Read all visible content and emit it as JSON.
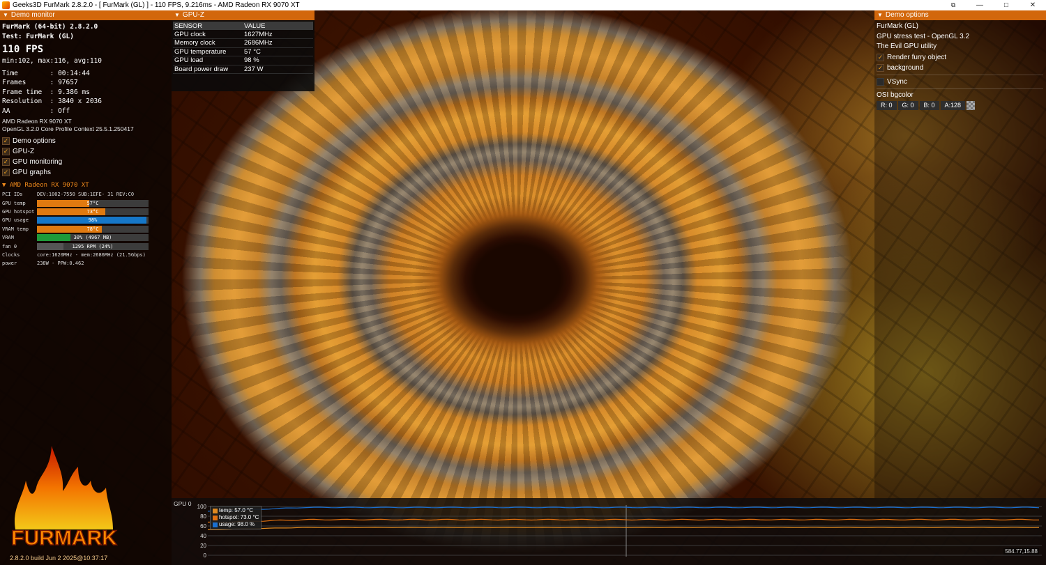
{
  "window": {
    "title": "Geeks3D FurMark 2.8.2.0 - [ FurMark (GL) ] - 110 FPS, 9.216ms - AMD Radeon RX 9070 XT",
    "minimize_glyph": "—",
    "maximize_glyph": "□",
    "close_glyph": "✕",
    "extra_glyph": "⧉"
  },
  "demo_monitor": {
    "header": "Demo monitor",
    "app_name": "FurMark (64-bit) 2.8.2.0",
    "test": "Test: FurMark (GL)",
    "fps": "110 FPS",
    "fps_stats": "min:102, max:116, avg:110",
    "time": "Time        : 00:14:44",
    "frames": "Frames      : 97657",
    "frame_time": "Frame time  : 9.386 ms",
    "resolution": "Resolution  : 3840 x 2036",
    "aa": "AA          : Off",
    "gpu_name": "AMD Radeon RX 9070 XT",
    "gl_context": "OpenGL 3.2.0 Core Profile Context 25.5.1.250417",
    "toggles": [
      {
        "label": "Demo options",
        "checked": true
      },
      {
        "label": "GPU-Z",
        "checked": true
      },
      {
        "label": "GPU monitoring",
        "checked": true
      },
      {
        "label": "GPU graphs",
        "checked": true
      }
    ],
    "gpu_section_header": "AMD Radeon RX 9070 XT",
    "pci_label": "PCI IDs",
    "pci_value": "DEV:1002-7550 SUB:1EFE-  31 REV:C0",
    "bars": [
      {
        "label": "GPU temp",
        "text": "57°C",
        "fraction": 0.47,
        "color": "#e07a10"
      },
      {
        "label": "GPU hotspot",
        "text": "73°C",
        "fraction": 0.61,
        "color": "#e07a10"
      },
      {
        "label": "GPU usage",
        "text": "98%",
        "fraction": 0.98,
        "color": "#1677c8"
      },
      {
        "label": "VRAM temp",
        "text": "78°C",
        "fraction": 0.58,
        "color": "#e07a10"
      },
      {
        "label": "VRAM",
        "text": "30% (4967 MB)",
        "fraction": 0.3,
        "color": "#1f9a3a"
      },
      {
        "label": "fan 0",
        "text": "1295 RPM (24%)",
        "fraction": 0.24,
        "color": "#555555"
      }
    ],
    "clocks_label": "Clocks",
    "clocks_value": "core:1620MHz - mem:2686MHz (21.5Gbps)",
    "power_label": "power",
    "power_value": "238W - PPW:0.462",
    "logo_text": "FURMARK",
    "build": "2.8.2.0 build Jun  2 2025@10:37:17"
  },
  "gpuz": {
    "header": "GPU-Z",
    "col_sensor": "SENSOR",
    "col_value": "VALUE",
    "rows": [
      {
        "sensor": "GPU clock",
        "value": "1627MHz"
      },
      {
        "sensor": "Memory clock",
        "value": "2686MHz"
      },
      {
        "sensor": "GPU temperature",
        "value": "57 °C"
      },
      {
        "sensor": "GPU load",
        "value": "98 %"
      },
      {
        "sensor": "Board power draw",
        "value": "237 W"
      }
    ]
  },
  "demo_options": {
    "header": "Demo options",
    "name": "FurMark (GL)",
    "description": "GPU stress test - OpenGL 3.2",
    "tagline": "The Evil GPU utility",
    "render_furry": {
      "label": "Render furry object",
      "checked": true
    },
    "background": {
      "label": "background",
      "checked": true
    },
    "vsync": {
      "label": "VSync",
      "checked": false
    },
    "osi_label": "OSI bgcolor",
    "osi": {
      "r": "R: 0",
      "g": "G: 0",
      "b": "B: 0",
      "a": "A:128"
    }
  },
  "graph": {
    "label": "GPU 0",
    "yticks": [
      "100",
      "80",
      "60",
      "40",
      "20",
      "0"
    ],
    "legend": [
      {
        "label": "temp: 57.0 °C",
        "color": "#e08a20"
      },
      {
        "label": "hotspot: 73.0 °C",
        "color": "#e07010"
      },
      {
        "label": "usage: 98.0 %",
        "color": "#1a6fd0"
      }
    ],
    "coord_readout": "584.77,15.88",
    "ymax": 100,
    "series_levels": {
      "usage": 98,
      "hotspot": 73,
      "temp": 57
    }
  }
}
